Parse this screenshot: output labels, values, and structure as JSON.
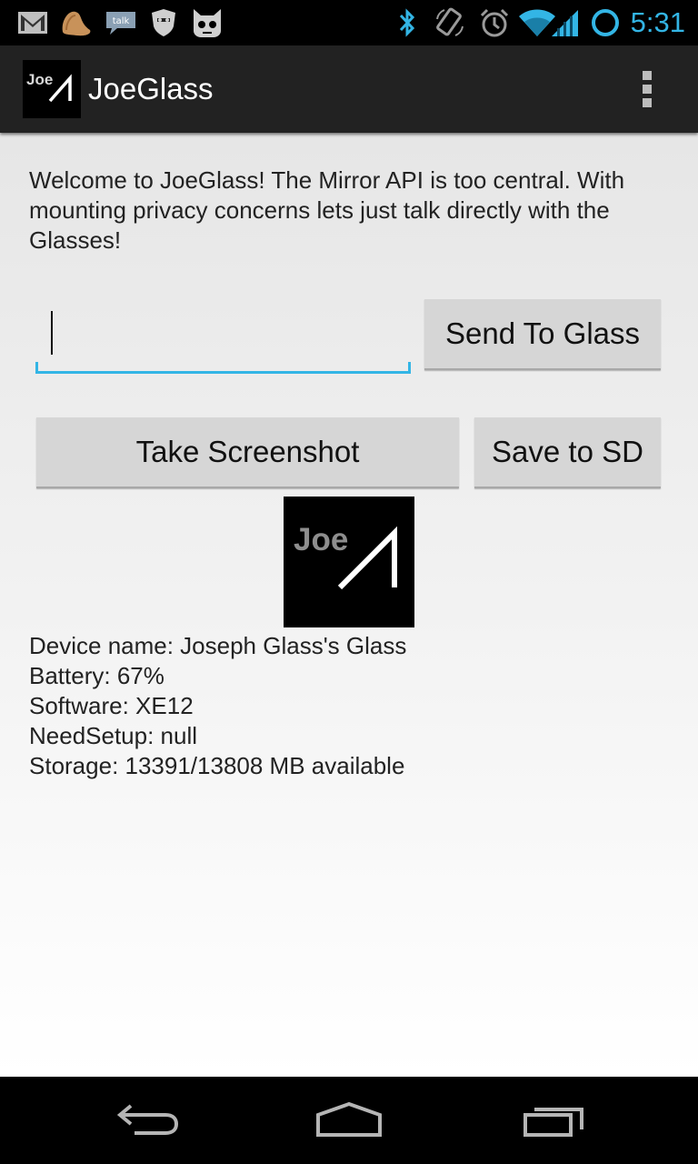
{
  "status_bar": {
    "time": "5:31",
    "icons": [
      "gmail-icon",
      "food-icon",
      "talk-icon",
      "shield-icon",
      "cyanogen-icon",
      "bluetooth-icon",
      "screen-rotate-icon",
      "alarm-icon",
      "wifi-icon",
      "signal-icon",
      "sync-circle-icon"
    ],
    "accent_color": "#33b5e5"
  },
  "action_bar": {
    "logo_text": "Joe",
    "title": "JoeGlass",
    "overflow_icon": "overflow-menu-icon"
  },
  "main": {
    "welcome_text": "Welcome to JoeGlass! The Mirror API is too central. With mounting privacy concerns lets just talk directly with the Glasses!",
    "message_input": {
      "value": "",
      "placeholder": ""
    },
    "send_button": "Send To Glass",
    "screenshot_button": "Take Screenshot",
    "save_button": "Save to SD",
    "logo_text": "Joe",
    "device_info": [
      "Device name: Joseph Glass's Glass",
      "Battery: 67%",
      "Software: XE12",
      "NeedSetup: null",
      "Storage: 13391/13808 MB available"
    ]
  },
  "nav_bar": {
    "icons": [
      "back-icon",
      "home-icon",
      "recents-icon"
    ]
  }
}
